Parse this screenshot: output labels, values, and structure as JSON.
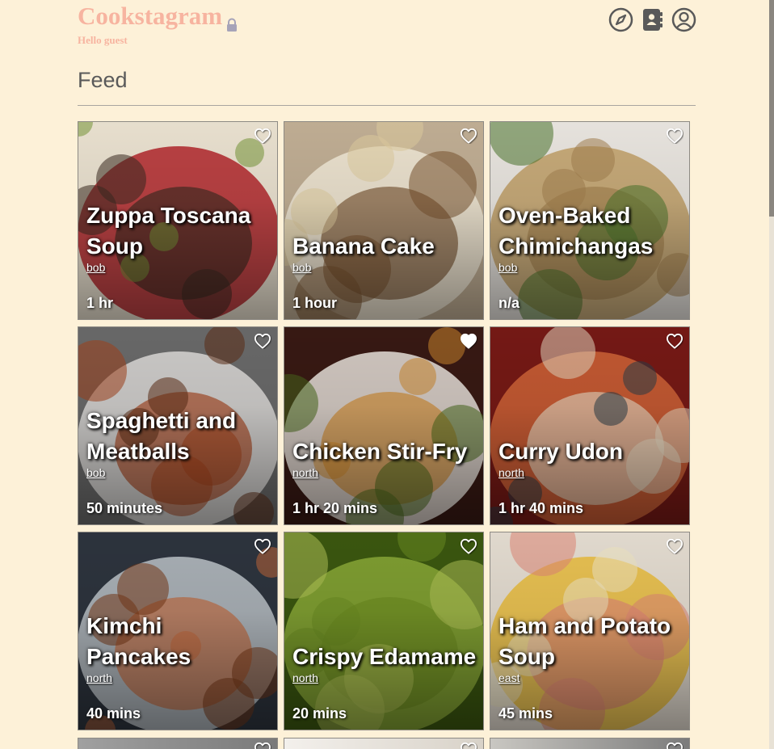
{
  "app": {
    "brand": "Cookstagram",
    "greeting": "Hello guest",
    "nav": [
      {
        "icon": "compass-icon",
        "label": ""
      },
      {
        "icon": "contacts-book-icon",
        "label": ""
      },
      {
        "icon": "user-circle-icon",
        "label": ""
      }
    ]
  },
  "page": {
    "title": "Feed"
  },
  "recipes": [
    {
      "title": "Zuppa Toscana Soup",
      "author": "bob",
      "time": "1 hr",
      "liked": false,
      "colors": [
        "#f3ead8",
        "#b8272d",
        "#3d2c22",
        "#7a9a3a"
      ]
    },
    {
      "title": "Banana Cake",
      "author": "bob",
      "time": "1 hour",
      "liked": false,
      "colors": [
        "#c8b59a",
        "#fbf3e0",
        "#7d5632",
        "#e8d3a5"
      ]
    },
    {
      "title": "Oven-Baked Chimichangas",
      "author": "bob",
      "time": "n/a",
      "liked": false,
      "colors": [
        "#f2eee8",
        "#c9a66b",
        "#a98552",
        "#4f7a2e"
      ]
    },
    {
      "title": "Spaghetti and Meatballs",
      "author": "bob",
      "time": "50 minutes",
      "liked": false,
      "colors": [
        "#6d6d6d",
        "#e6e4e2",
        "#a8441c",
        "#5e2d16"
      ]
    },
    {
      "title": "Chicken Stir-Fry",
      "author": "north",
      "time": "1 hr 20 mins",
      "liked": true,
      "colors": [
        "#3a1a14",
        "#f4efe6",
        "#d28b2e",
        "#4a6b1c"
      ]
    },
    {
      "title": "Curry Udon",
      "author": "north",
      "time": "1 hr 40 mins",
      "liked": false,
      "colors": [
        "#7a1a16",
        "#d8683a",
        "#eadcc4",
        "#2c3f4a"
      ]
    },
    {
      "title": "Kimchi Pancakes",
      "author": "north",
      "time": "40 mins",
      "liked": false,
      "colors": [
        "#2f3640",
        "#c5ccd2",
        "#c66a3a",
        "#7a3a18"
      ]
    },
    {
      "title": "Crispy Edamame",
      "author": "north",
      "time": "20 mins",
      "liked": false,
      "colors": [
        "#3d5a10",
        "#8fb03a",
        "#6e8f22",
        "#b6c95a"
      ]
    },
    {
      "title": "Ham and Potato Soup",
      "author": "east",
      "time": "45 mins",
      "liked": false,
      "colors": [
        "#ece4d8",
        "#f2c33e",
        "#e88a7a",
        "#f7ecc8"
      ]
    }
  ],
  "partial_row": [
    {
      "colors": [
        "#a0a0a0",
        "#7a7a7a"
      ]
    },
    {
      "colors": [
        "#f3f0ec",
        "#d8d2c8"
      ]
    },
    {
      "colors": [
        "#c9c7c2",
        "#7b7b7b"
      ]
    }
  ],
  "theme": {
    "background": "#fdf1d8",
    "brand_color": "#f7b4a0",
    "title_color": "#5a5a5a"
  }
}
